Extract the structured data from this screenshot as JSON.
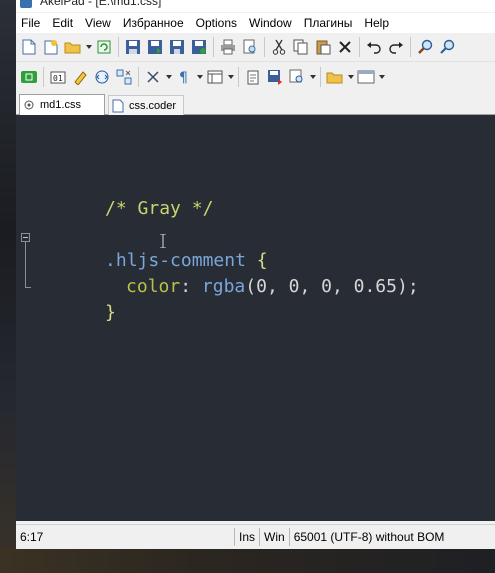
{
  "window": {
    "title": "AkelPad - [E:\\md1.css]"
  },
  "menu": {
    "items": [
      "File",
      "Edit",
      "View",
      "Избранное",
      "Options",
      "Window",
      "Плагины",
      "Help"
    ]
  },
  "toolbar1": {
    "icons": [
      "new-file-icon",
      "new-window-icon",
      "open-icon",
      "open-dropdown",
      "reopen-icon",
      "save-icon",
      "save-all-icon",
      "save-as-icon",
      "save-all-as-icon",
      "print-icon",
      "print-preview-icon",
      "cut-icon",
      "copy-icon",
      "paste-icon",
      "delete-icon",
      "undo-icon",
      "redo-icon",
      "find-icon",
      "replace-icon"
    ]
  },
  "toolbar2": {
    "icons": [
      "run-icon",
      "hex-icon",
      "highlight-icon",
      "coder-icon",
      "settings-icon",
      "wrap-icon",
      "pilcrow-icon",
      "columns-icon",
      "clipboard-icon",
      "save-session-icon",
      "zoom-icon",
      "folder-icon",
      "window-icon"
    ]
  },
  "tabs": [
    {
      "label": "md1.css",
      "active": true
    },
    {
      "label": "css.coder",
      "active": false
    }
  ],
  "editor": {
    "lines": {
      "comment": "/* Gray */",
      "selector": ".hljs-comment",
      "open_brace": " {",
      "prop": "color",
      "colon": ": ",
      "fn": "rgba",
      "args": "(0, 0, 0, 0.65);",
      "close_brace": "}"
    }
  },
  "status": {
    "position": "6:17",
    "insert_mode": "Ins",
    "newline": "Win",
    "encoding": "65001 (UTF-8) without BOM"
  }
}
